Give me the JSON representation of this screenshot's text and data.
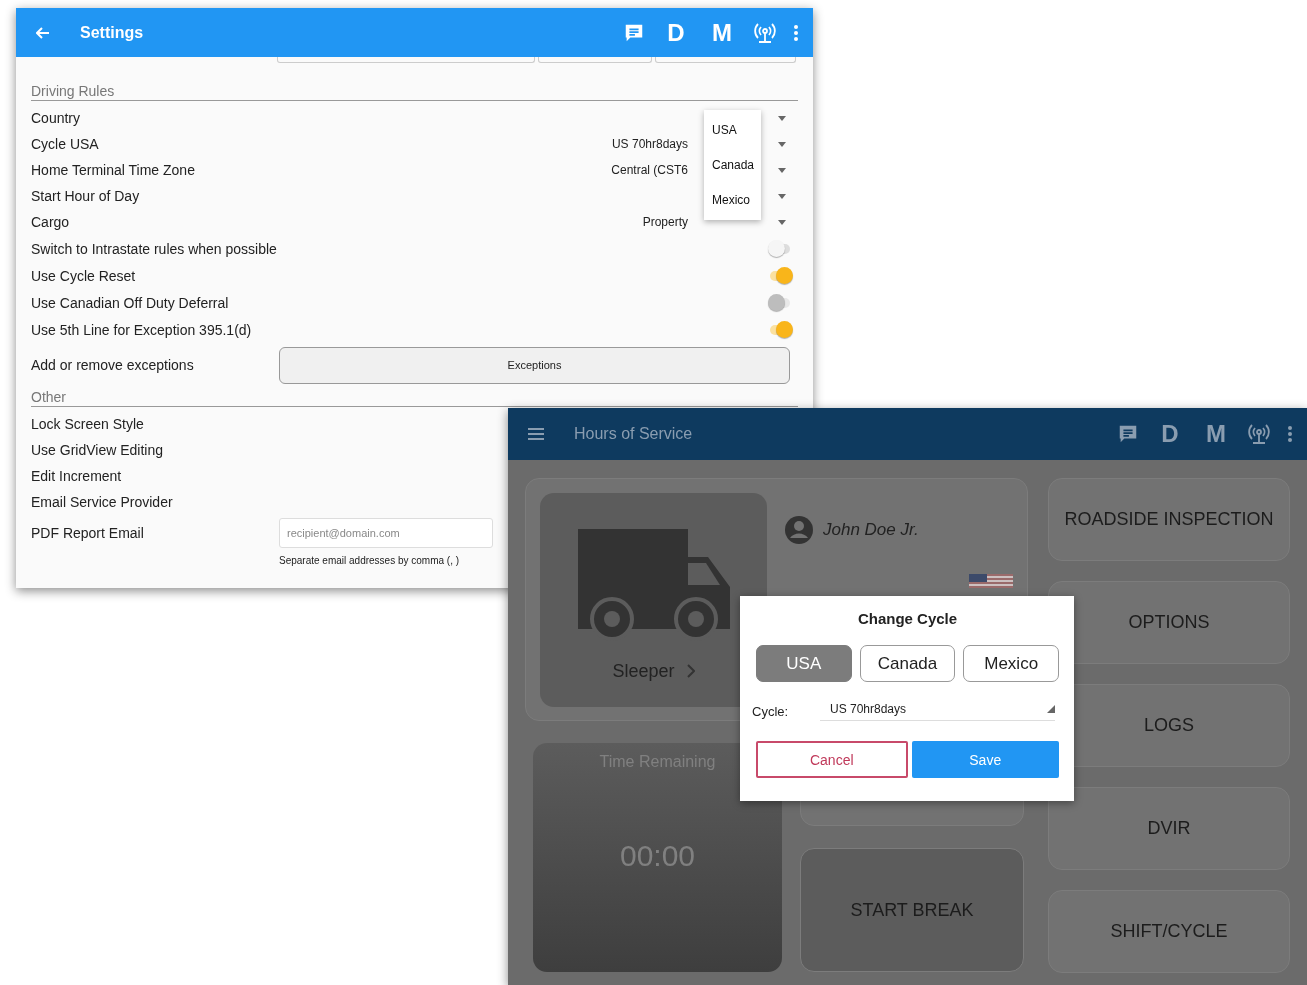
{
  "settings": {
    "title": "Settings",
    "badges": [
      "D",
      "M"
    ],
    "driving_rules": {
      "heading": "Driving Rules",
      "rows": [
        {
          "kind": "select",
          "label": "Country"
        },
        {
          "kind": "select",
          "label": "Cycle USA",
          "value": "US 70hr8days"
        },
        {
          "kind": "select",
          "label": "Home Terminal Time Zone",
          "value": "Central (CST6"
        },
        {
          "kind": "select",
          "label": "Start Hour of Day"
        },
        {
          "kind": "select",
          "label": "Cargo",
          "value": "Property"
        },
        {
          "kind": "toggle",
          "label": "Switch to Intrastate rules when possible",
          "on": false,
          "disabled": false
        },
        {
          "kind": "toggle",
          "label": "Use Cycle Reset",
          "on": true,
          "disabled": false
        },
        {
          "kind": "toggle",
          "label": "Use Canadian Off Duty Deferral",
          "on": false,
          "disabled": true
        },
        {
          "kind": "toggle",
          "label": "Use 5th Line for Exception 395.1(d)",
          "on": true,
          "disabled": false
        },
        {
          "kind": "button",
          "label": "Add or remove exceptions",
          "button": "Exceptions"
        }
      ]
    },
    "country_menu": [
      "USA",
      "Canada",
      "Mexico"
    ],
    "other": {
      "heading": "Other",
      "rows": [
        {
          "kind": "plain",
          "label": "Lock Screen Style"
        },
        {
          "kind": "plain",
          "label": "Use GridView Editing"
        },
        {
          "kind": "plain",
          "label": "Edit Increment"
        },
        {
          "kind": "plain",
          "label": "Email Service Provider"
        },
        {
          "kind": "email",
          "label": "PDF Report Email",
          "placeholder": "recipient@domain.com",
          "hint": "Separate email addresses by comma (, )"
        }
      ]
    }
  },
  "hos": {
    "title": "Hours of Service",
    "badges": [
      "D",
      "M"
    ],
    "status": "Sleeper",
    "driver": "John Doe Jr.",
    "time_label": "Time Remaining",
    "time_value": "00:00",
    "center_buttons": [
      "START BREAK"
    ],
    "side_buttons": [
      "ROADSIDE INSPECTION",
      "OPTIONS",
      "LOGS",
      "DVIR",
      "SHIFT/CYCLE"
    ]
  },
  "dialog": {
    "title": "Change Cycle",
    "countries": [
      {
        "label": "USA",
        "selected": true
      },
      {
        "label": "Canada",
        "selected": false
      },
      {
        "label": "Mexico",
        "selected": false
      }
    ],
    "cycle_label": "Cycle:",
    "cycle_value": "US 70hr8days",
    "cancel": "Cancel",
    "save": "Save"
  }
}
